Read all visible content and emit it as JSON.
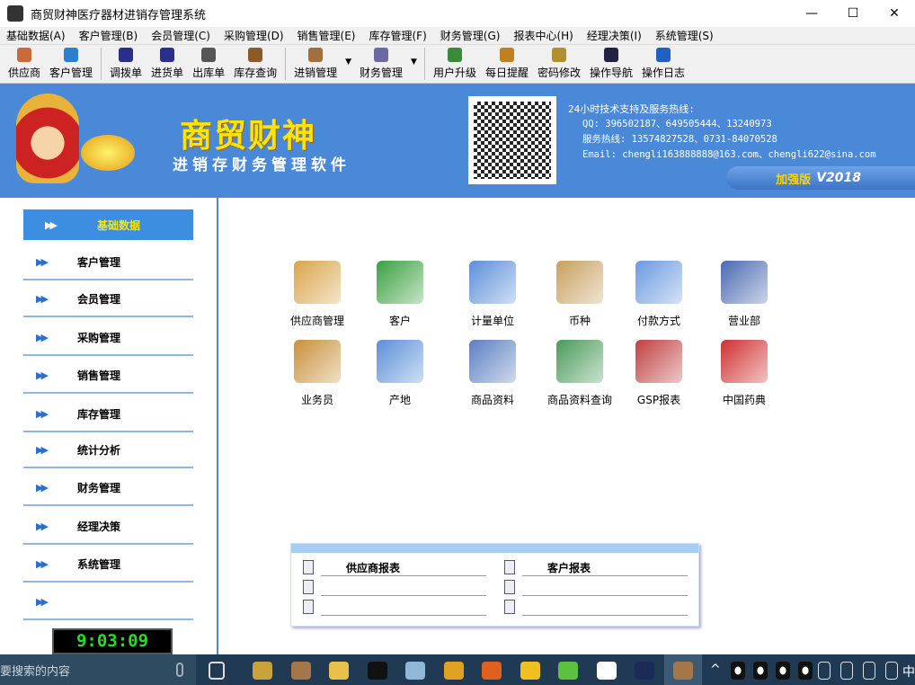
{
  "window": {
    "title": "商贸财神医疗器材进销存管理系统",
    "minimize": "—",
    "maximize": "☐",
    "close": "✕"
  },
  "menu": [
    "基础数据(A)",
    "客户管理(B)",
    "会员管理(C)",
    "采购管理(D)",
    "销售管理(E)",
    "库存管理(F)",
    "财务管理(G)",
    "报表中心(H)",
    "经理决策(I)",
    "系统管理(S)"
  ],
  "toolbar": [
    {
      "label": "供应商",
      "color": "#c86a3a"
    },
    {
      "label": "客户管理",
      "color": "#2a7fd0"
    },
    {
      "sep": true
    },
    {
      "label": "调拨单",
      "color": "#2b2e8a"
    },
    {
      "label": "进货单",
      "color": "#2b2e8a"
    },
    {
      "label": "出库单",
      "color": "#555"
    },
    {
      "label": "库存查询",
      "color": "#8b5a2b"
    },
    {
      "sep": true
    },
    {
      "label": "进销管理",
      "color": "#a07040",
      "dropdown": true
    },
    {
      "label": "财务管理",
      "color": "#6a6aa0",
      "dropdown": true
    },
    {
      "sep": true
    },
    {
      "label": "用户升级",
      "color": "#3a8a3a"
    },
    {
      "label": "每日提醒",
      "color": "#c08020"
    },
    {
      "label": "密码修改",
      "color": "#b09030"
    },
    {
      "label": "操作导航",
      "color": "#224"
    },
    {
      "label": "操作日志",
      "color": "#2060c0"
    }
  ],
  "banner": {
    "brand": "商贸财神",
    "subtitle": "进销存财务管理软件",
    "support_title": "24小时技术支持及服务热线:",
    "qq": "QQ: 396502187、649505444、13240973",
    "hotline": "服务热线: 13574827528、0731-84070528",
    "email": "Email: chengli163888888@163.com、chengli622@sina.com",
    "edition": "加强版",
    "version": "V2018"
  },
  "sidebar": {
    "items": [
      "基础数据",
      "客户管理",
      "会员管理",
      "采购管理",
      "销售管理",
      "库存管理",
      "统计分析",
      "财务管理",
      "经理决策",
      "系统管理",
      ""
    ],
    "selected": 0,
    "arrow": "▶▶"
  },
  "clock": "9:03:09",
  "modules": [
    {
      "label": "供应商管理",
      "icon": "supplier-icon",
      "color": "#d9a44a"
    },
    {
      "label": "客户",
      "icon": "customer-icon",
      "color": "#3aa040"
    },
    {
      "label": "计量单位",
      "icon": "unit-folder-icon",
      "color": "#5b8fd8"
    },
    {
      "label": "币种",
      "icon": "currency-clipboard-icon",
      "color": "#c8a060"
    },
    {
      "label": "付款方式",
      "icon": "payment-folder-icon",
      "color": "#6a9ae0"
    },
    {
      "label": "营业部",
      "icon": "branch-folder-icon",
      "color": "#4a6ab0"
    },
    {
      "label": "业务员",
      "icon": "salesman-folder-icon",
      "color": "#c8903a"
    },
    {
      "label": "产地",
      "icon": "origin-folder-icon",
      "color": "#5b8fd8"
    },
    {
      "label": "商品资料",
      "icon": "goods-folder-icon",
      "color": "#5a7fc0"
    },
    {
      "label": "商品资料查询",
      "icon": "goods-query-icon",
      "color": "#4a9a5a"
    },
    {
      "label": "GSP报表",
      "icon": "gsp-report-icon",
      "color": "#c04040"
    },
    {
      "label": "中国药典",
      "icon": "pharmacopoeia-icon",
      "color": "#d03030"
    }
  ],
  "reports": {
    "left": [
      "供应商报表",
      "",
      ""
    ],
    "right": [
      "客户报表",
      "",
      ""
    ]
  },
  "taskbar": {
    "search_placeholder": "要搜索的内容",
    "ime": "中",
    "apps": [
      "#c9a23c",
      "#a5764a",
      "#e8c04a",
      "#111",
      "#8fb8d8",
      "#e0a020",
      "#e06020",
      "#f0c020",
      "#5cc040",
      "#fff",
      "#1c2a5a",
      "#a5764a"
    ]
  }
}
